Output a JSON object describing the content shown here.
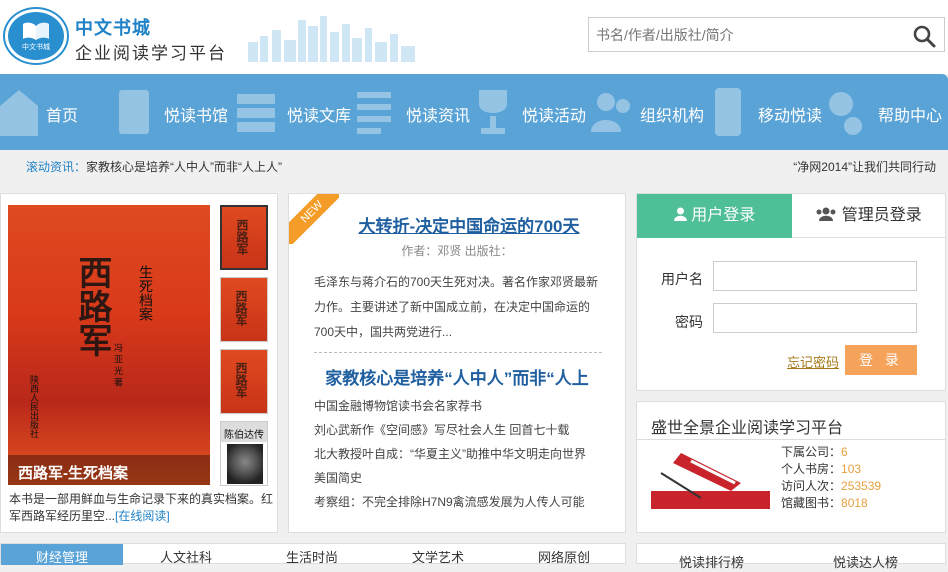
{
  "brand": {
    "name": "中文书城",
    "tagline": "企业阅读学习平台",
    "logo_mark": "中文书城"
  },
  "search": {
    "placeholder": "书名/作者/出版社/简介",
    "icon": "search-icon"
  },
  "nav": {
    "color": "#5aa3d6",
    "items": [
      {
        "label": "首页",
        "icon": "home-icon"
      },
      {
        "label": "悦读书馆",
        "icon": "book-icon"
      },
      {
        "label": "悦读文库",
        "icon": "library-icon"
      },
      {
        "label": "悦读资讯",
        "icon": "news-icon"
      },
      {
        "label": "悦读活动",
        "icon": "trophy-icon"
      },
      {
        "label": "组织机构",
        "icon": "users-icon"
      },
      {
        "label": "移动悦读",
        "icon": "mobile-icon"
      },
      {
        "label": "帮助中心",
        "icon": "gear-icon"
      }
    ]
  },
  "ticker": {
    "prefix": "滚动资讯：",
    "left_text": "家教核心是培养“人中人”而非“人上人”",
    "right_text": "“净网2014”让我们共同行动"
  },
  "featured_book": {
    "caption": "西路军-生死档案",
    "cover_title": "西路军",
    "cover_subtitle": "生死档案",
    "cover_author": "冯 亚 光 著",
    "cover_publisher": "陕西人民出版社",
    "thumb_last_title": "陈伯达传",
    "description": "本书是一部用鲜血与生命记录下来的真实档案。红军西路军经历里空...",
    "read_link": "[在线阅读]"
  },
  "news": {
    "badge": "NEW",
    "headline": "大转折-决定中国命运的700天",
    "meta": "作者：邓贤 出版社：",
    "summary": "毛泽东与蒋介石的700天生死对决。著名作家邓贤最新力作。主要讲述了新中国成立前，在决定中国命运的700天中，国共两党进行...",
    "second_headline": "家教核心是培养“人中人”而非“人上",
    "items": [
      "中国金融博物馆读书会名家荐书",
      "刘心武新作《空间感》写尽社会人生 回首七十载",
      "北大教授叶自成：“华夏主义”助推中华文明走向世界",
      "美国简史",
      "考察组：不完全排除H7N9禽流感发展为人传人可能"
    ]
  },
  "login": {
    "tab_user": "用户登录",
    "tab_admin": "管理员登录",
    "username_label": "用户名",
    "password_label": "密码",
    "forgot": "忘记密码",
    "submit": "登 录",
    "accent": "#4fbf98",
    "button_color": "#f5a25a"
  },
  "platform": {
    "title": "盛世全景企业阅读学习平台",
    "stats": [
      {
        "label": "下属公司：",
        "value": "6"
      },
      {
        "label": "个人书房：",
        "value": "103"
      },
      {
        "label": "访问人次：",
        "value": "253539"
      },
      {
        "label": "馆藏图书：",
        "value": "8018"
      }
    ]
  },
  "bottom_tabs": [
    "财经管理",
    "人文社科",
    "生活时尚",
    "文学艺术",
    "网络原创"
  ],
  "bottom_right": [
    "悦读排行榜",
    "悦读达人榜"
  ]
}
